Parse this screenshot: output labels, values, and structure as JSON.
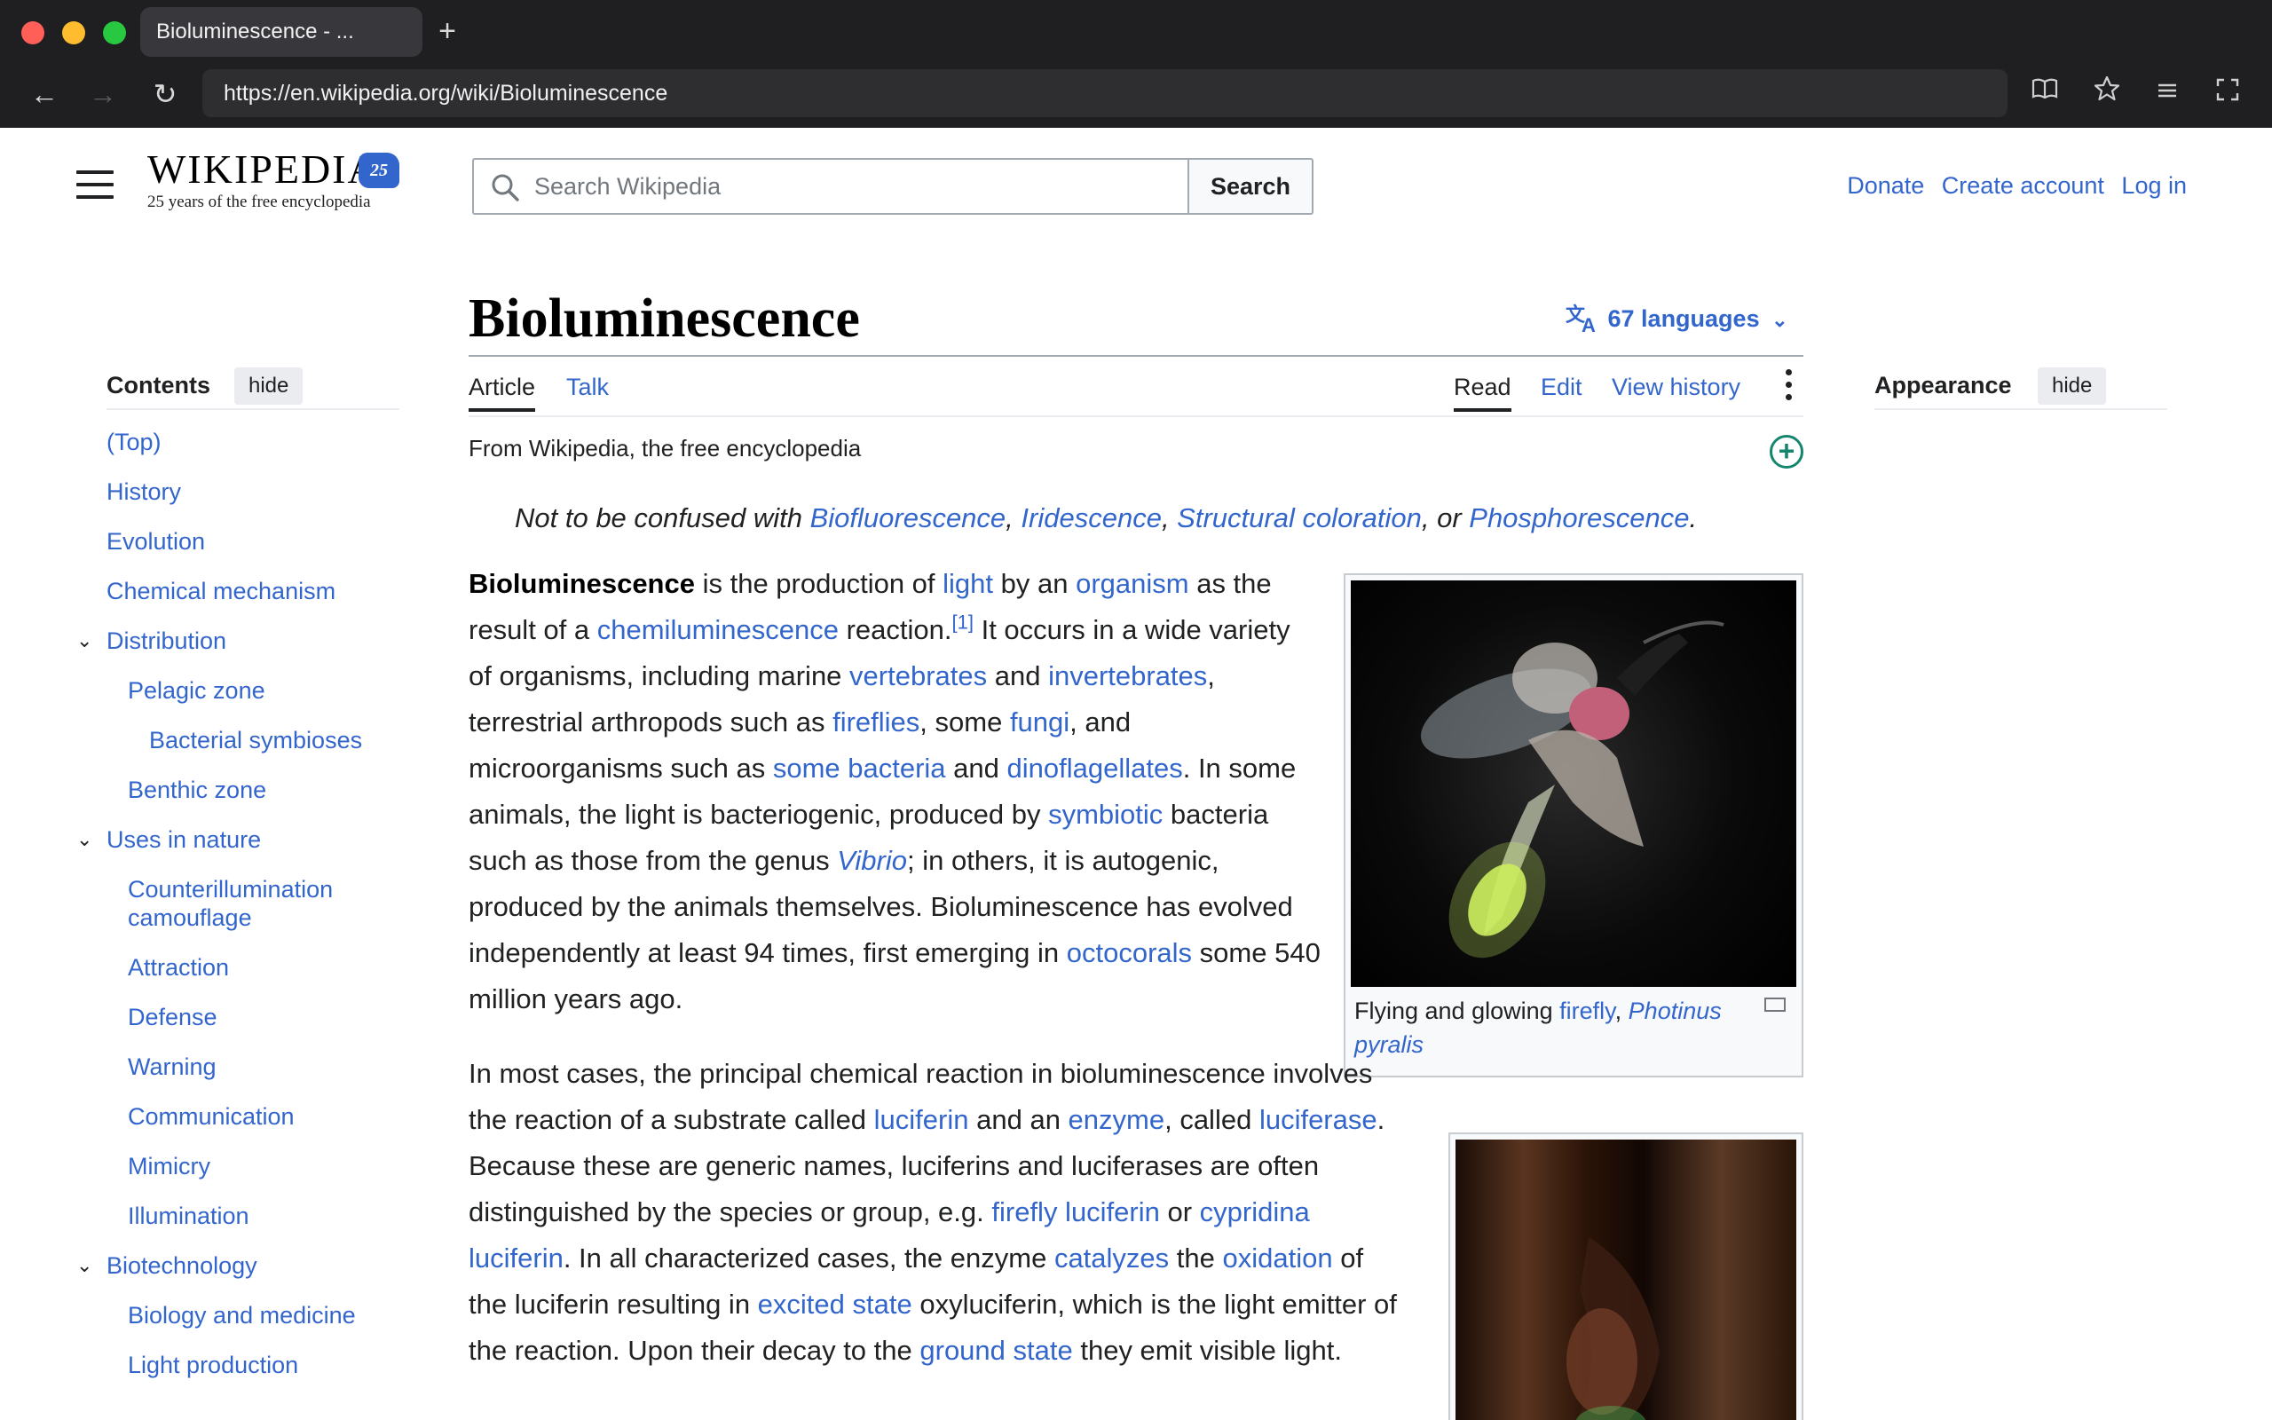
{
  "browser": {
    "tab_title": "Bioluminescence - ...",
    "new_tab": "+",
    "url": "https://en.wikipedia.org/wiki/Bioluminescence",
    "back": "←",
    "forward": "→",
    "reload": "↻",
    "icons": [
      "reader-icon",
      "bookmark-star-icon",
      "menu-icon",
      "fullscreen-icon"
    ],
    "colors": {
      "chrome": "#1f1f21",
      "close": "#ff5f57",
      "minimize": "#febc2e",
      "zoom": "#28c840"
    }
  },
  "header": {
    "logo_wordmark": "WIKIPEDIA",
    "logo_badge": "25",
    "logo_tagline": "25 years of the free encyclopedia",
    "search_placeholder": "Search Wikipedia",
    "search_button": "Search",
    "user_links": {
      "donate": "Donate",
      "create_account": "Create account",
      "log_in": "Log in"
    }
  },
  "toc": {
    "title": "Contents",
    "hide": "hide",
    "items": [
      {
        "label": "(Top)",
        "level": 1
      },
      {
        "label": "History",
        "level": 1
      },
      {
        "label": "Evolution",
        "level": 1
      },
      {
        "label": "Chemical mechanism",
        "level": 1
      },
      {
        "label": "Distribution",
        "level": 1,
        "expandable": true
      },
      {
        "label": "Pelagic zone",
        "level": 2
      },
      {
        "label": "Bacterial symbioses",
        "level": 3
      },
      {
        "label": "Benthic zone",
        "level": 2
      },
      {
        "label": "Uses in nature",
        "level": 1,
        "expandable": true
      },
      {
        "label": "Counterillumination camouflage",
        "level": 2
      },
      {
        "label": "Attraction",
        "level": 2
      },
      {
        "label": "Defense",
        "level": 2
      },
      {
        "label": "Warning",
        "level": 2
      },
      {
        "label": "Communication",
        "level": 2
      },
      {
        "label": "Mimicry",
        "level": 2
      },
      {
        "label": "Illumination",
        "level": 2
      },
      {
        "label": "Biotechnology",
        "level": 1,
        "expandable": true
      },
      {
        "label": "Biology and medicine",
        "level": 2
      },
      {
        "label": "Light production",
        "level": 2
      }
    ]
  },
  "article": {
    "title": "Bioluminescence",
    "languages": "67 languages",
    "tabs": {
      "article": "Article",
      "talk": "Talk",
      "read": "Read",
      "edit": "Edit",
      "history": "View history"
    },
    "from": "From Wikipedia, the free encyclopedia",
    "hatnote": {
      "prefix": "Not to be confused with ",
      "links": [
        "Biofluorescence",
        "Iridescence",
        "Structural coloration",
        "Phosphorescence"
      ],
      "sep1": ", ",
      "sep2": ", ",
      "sep3": ", or ",
      "end": "."
    },
    "para1": {
      "bold": "Bioluminescence",
      "t1": " is the production of ",
      "l1": "light",
      "t2": " by an ",
      "l2": "organism",
      "t3": " as the result of a ",
      "l3": "chemiluminescence",
      "t4": " reaction.",
      "ref1": "[1]",
      "t5": " It occurs in a wide variety of organisms, including marine ",
      "l4": "vertebrates",
      "t6": " and ",
      "l5": "invertebrates",
      "t7": ", terrestrial arthropods such as ",
      "l6": "fireflies",
      "t8": ", some ",
      "l7": "fungi",
      "t9": ", and microorganisms such as ",
      "l8": "some bacteria",
      "t10": " and ",
      "l9": "dinoflagellates",
      "t11": ". In some animals, the light is bacteriogenic, produced by ",
      "l10": "symbiotic",
      "t12": " bacteria such as those from the genus ",
      "l11": "Vibrio",
      "t13": "; in others, it is autogenic, produced by the animals themselves. Bioluminescence has evolved independently at least 94 times, first emerging in ",
      "l12": "octocorals",
      "t14": " some 540 million years ago."
    },
    "para2": {
      "t1": "In most cases, the principal chemical reaction in bioluminescence involves the reaction of a substrate called ",
      "l1": "luciferin",
      "t2": " and an ",
      "l2": "enzyme",
      "t3": ", called ",
      "l3": "luciferase",
      "t4": ". Because these are generic names, luciferins and luciferases are often distinguished by the species or group, e.g. ",
      "l4": "firefly luciferin",
      "t5": " or ",
      "l5": "cypridina luciferin",
      "t6": ". In all characterized cases, the enzyme ",
      "l6": "catalyzes",
      "t7": " the ",
      "l7": "oxidation",
      "t8": " of the luciferin resulting in ",
      "l8": "excited state",
      "t9": " oxyluciferin, which is the light emitter of the reaction. Upon their decay to the ",
      "l9": "ground state",
      "t10": " they emit visible light."
    },
    "figure1": {
      "t1": "Flying and glowing ",
      "l1": "firefly",
      "t2": ", ",
      "l2": "Photinus pyralis"
    }
  },
  "appearance": {
    "title": "Appearance",
    "hide": "hide"
  }
}
